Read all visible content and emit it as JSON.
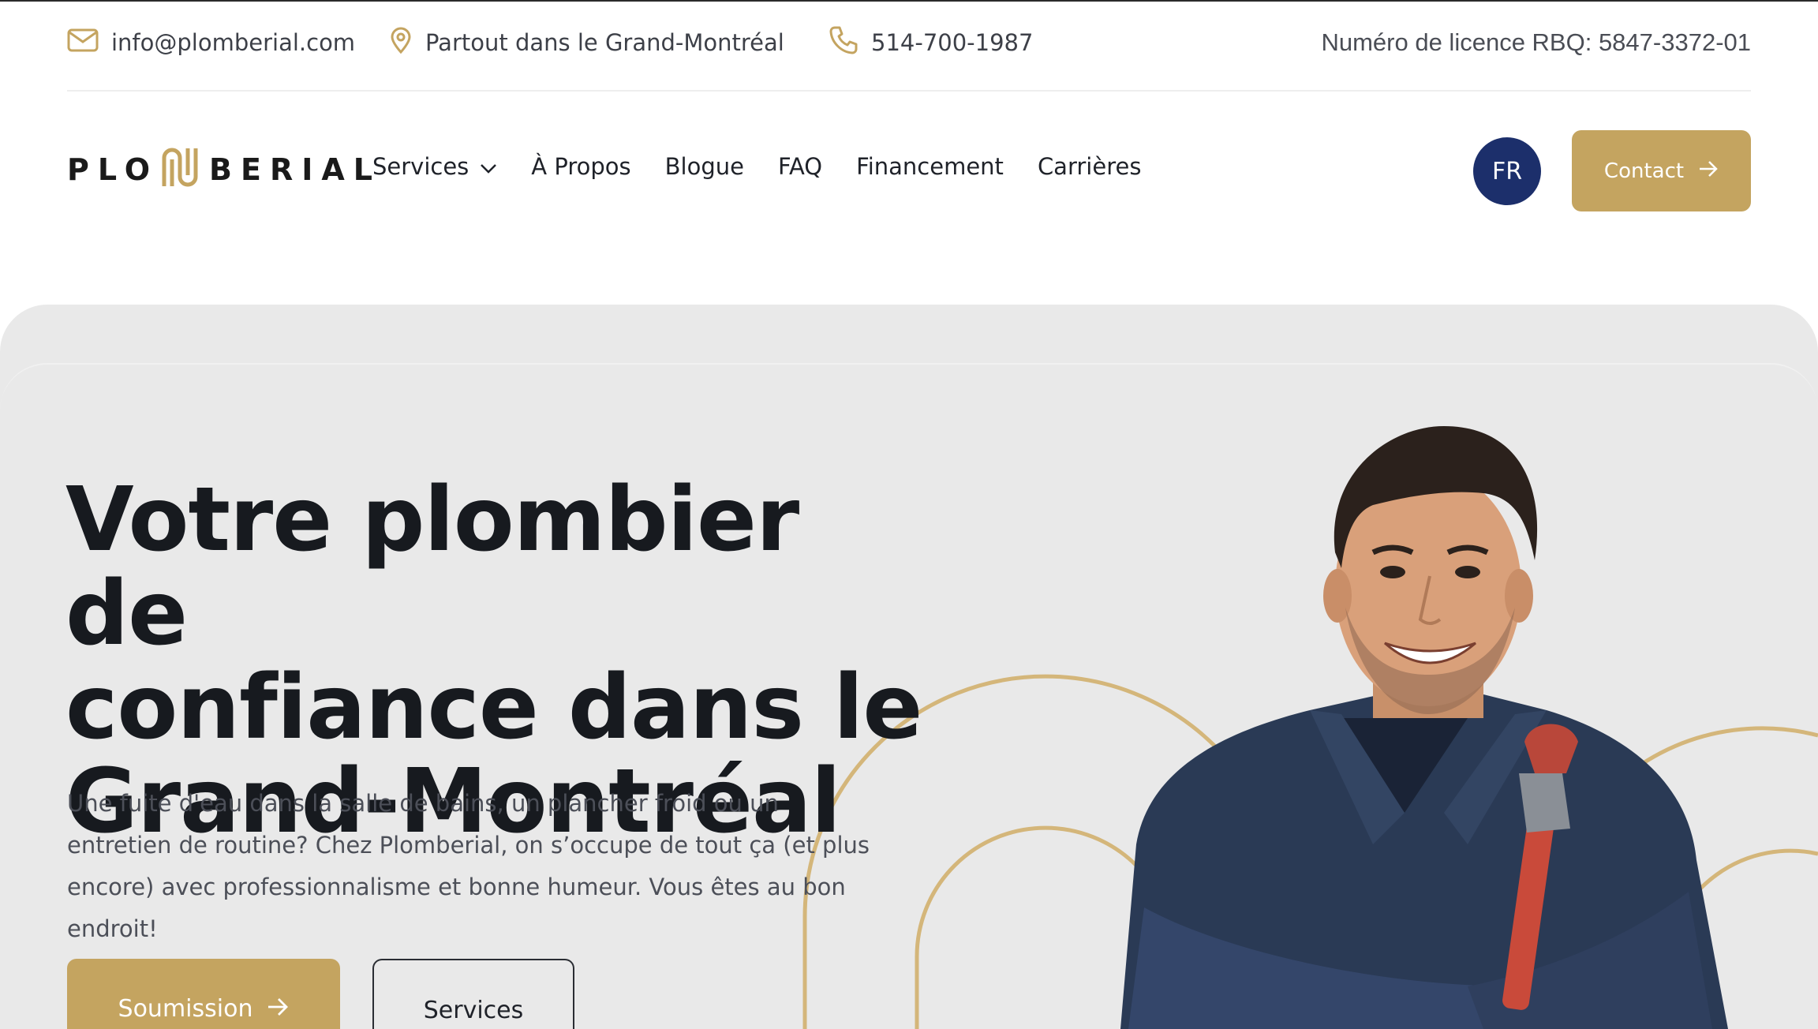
{
  "topbar": {
    "email": "info@plomberial.com",
    "location": "Partout dans le Grand-Montréal",
    "phone": "514-700-1987",
    "licence": "Numéro de licence RBQ: 5847-3372-01"
  },
  "brand": {
    "logo_left": "PLO",
    "logo_right": "BERIAL",
    "accent_color": "#c4a460",
    "navy_color": "#1c2f6b"
  },
  "nav": {
    "items": [
      {
        "label": "Services",
        "has_dropdown": true
      },
      {
        "label": "À Propos"
      },
      {
        "label": "Blogue"
      },
      {
        "label": "FAQ"
      },
      {
        "label": "Financement"
      },
      {
        "label": "Carrières"
      }
    ],
    "language": "FR",
    "contact_label": "Contact"
  },
  "hero": {
    "title_line1": "Votre plombier de",
    "title_line2": "confiance dans le",
    "title_line3": "Grand-Montréal",
    "description": "Une fuite d'eau dans la salle de bains, un plancher froid ou un entretien de routine? Chez Plomberial, on s’occupe de tout ça (et plus encore) avec professionnalisme et bonne humeur. Vous êtes au bon endroit!",
    "primary_button": "Soumission",
    "secondary_button": "Services"
  },
  "icons": {
    "email": "mail-icon",
    "location": "map-pin-icon",
    "phone": "phone-icon",
    "dropdown": "chevron-down-icon",
    "arrow": "arrow-right-icon"
  }
}
